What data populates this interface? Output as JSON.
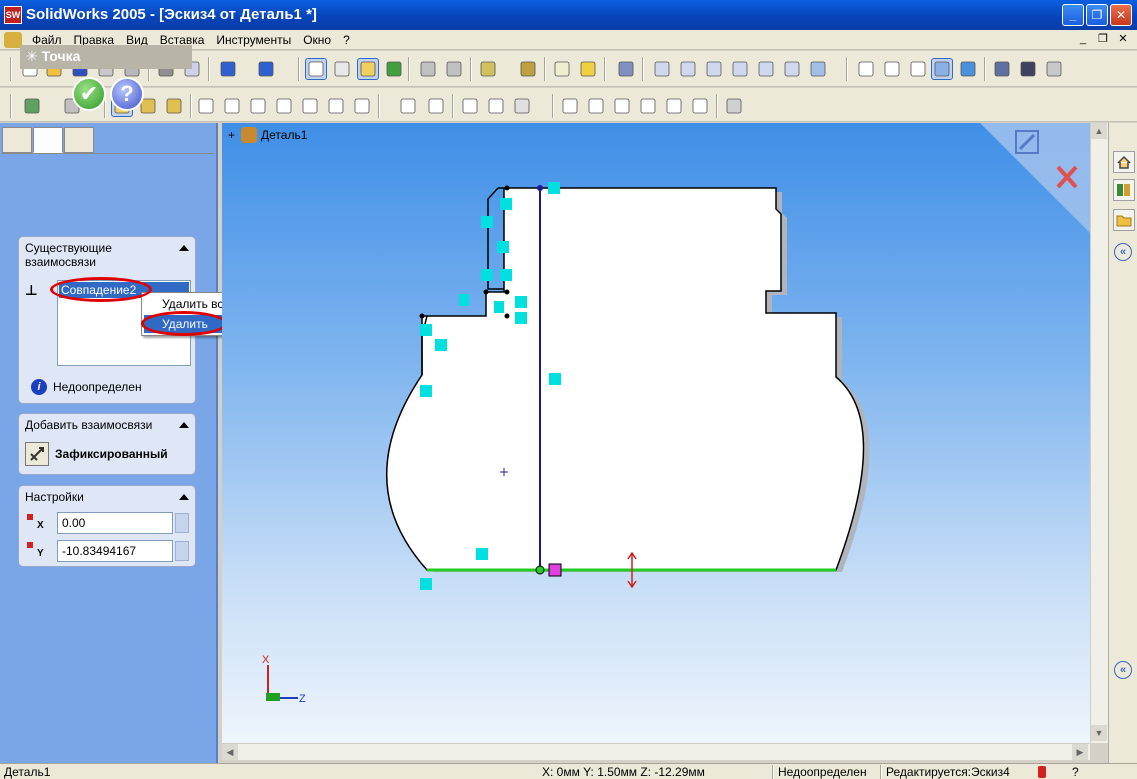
{
  "window": {
    "title": "SolidWorks 2005 - [Эскиз4 от Деталь1 *]",
    "app_icon": "SW",
    "minimize": "_",
    "maximize": "❐",
    "close": "✕"
  },
  "menu": {
    "items": [
      "Файл",
      "Правка",
      "Вид",
      "Вставка",
      "Инструменты",
      "Окно",
      "?"
    ],
    "mdi": [
      "_",
      "❐",
      "✕"
    ]
  },
  "property_manager": {
    "title": "Точка",
    "title_icon": "✳",
    "ok": "✔",
    "help": "?",
    "existing_relations": {
      "title": "Существующие взаимосвязи",
      "items": [
        "Совпадение2"
      ],
      "status": "Недоопределен",
      "info_glyph": "i"
    },
    "add_relations": {
      "title": "Добавить взаимосвязи",
      "fixed_label": "Зафиксированный"
    },
    "parameters": {
      "title": "Настройки",
      "x_label": "X",
      "x_value": "0.00",
      "y_label": "Y",
      "y_value": "-10.83494167"
    }
  },
  "context_menu": {
    "items": [
      "Удалить все",
      "Удалить"
    ],
    "highlighted": "Удалить"
  },
  "feature_tree": {
    "expand": "+",
    "root": "Деталь1"
  },
  "triad": {
    "x_label": "X",
    "z_label": "Z"
  },
  "statusbar": {
    "left": "Деталь1",
    "coords": "X: 0мм  Y: 1.50мм  Z: -12.29мм",
    "state": "Недоопределен",
    "editing": "Редактируется:Эскиз4"
  },
  "colors": {
    "title_bar": "#0842b8",
    "viewport_top": "#3f8fe8",
    "sketch_line": "#000000",
    "centerline": "#1a1aa0",
    "selected_line": "#22cc22",
    "relation_icon": "#00e0e0",
    "highlight_ring": "#e00000"
  }
}
